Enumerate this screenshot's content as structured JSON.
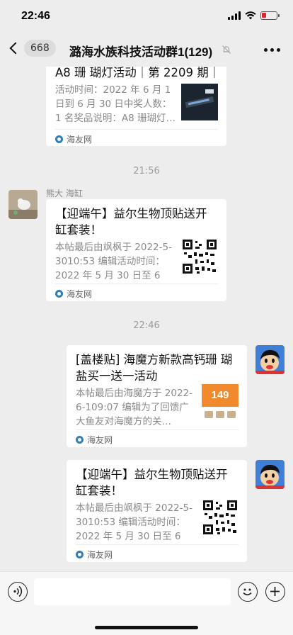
{
  "status_bar": {
    "time": "22:46"
  },
  "nav": {
    "back_count": "668",
    "title": "潞海水族科技活动群1(129)"
  },
  "messages": [
    {
      "title": "A8 珊 瑚灯活动｜第 2209 期｜",
      "description": "活动时间：2022 年 6 月 1 日到 6 月 30 日中奖人数：1 名奖品说明：A8 珊瑚灯…",
      "source": "海友网"
    },
    {
      "time": "21:56"
    },
    {
      "sender": "熊大 海缸",
      "title": "【迎端午】益尔生物顶贴送开缸套装！",
      "description": "本帖最后由飒枫于 2022-5-3010:53 编辑活动时间：2022 年 5 月 30 日至 6 月…",
      "source": "海友网"
    },
    {
      "time": "22:46"
    },
    {
      "title": "[盖楼贴] 海魔方新款高钙珊 瑚盐买一送一活动",
      "description": "本帖最后由海魔方于 2022-6-109:07 编辑为了回馈广大鱼友对海魔方的关…",
      "source": "海友网",
      "thumb_text": "149"
    },
    {
      "title": "【迎端午】益尔生物顶贴送开缸套装！",
      "description": "本帖最后由飒枫于 2022-5-3010:53 编辑活动时间：2022 年 5 月 30 日至 6 月…",
      "source": "海友网"
    }
  ],
  "colors": {
    "background": "#ededed",
    "card": "#ffffff",
    "muted_text": "#8a8a8a",
    "battery_low": "#e0262c"
  }
}
